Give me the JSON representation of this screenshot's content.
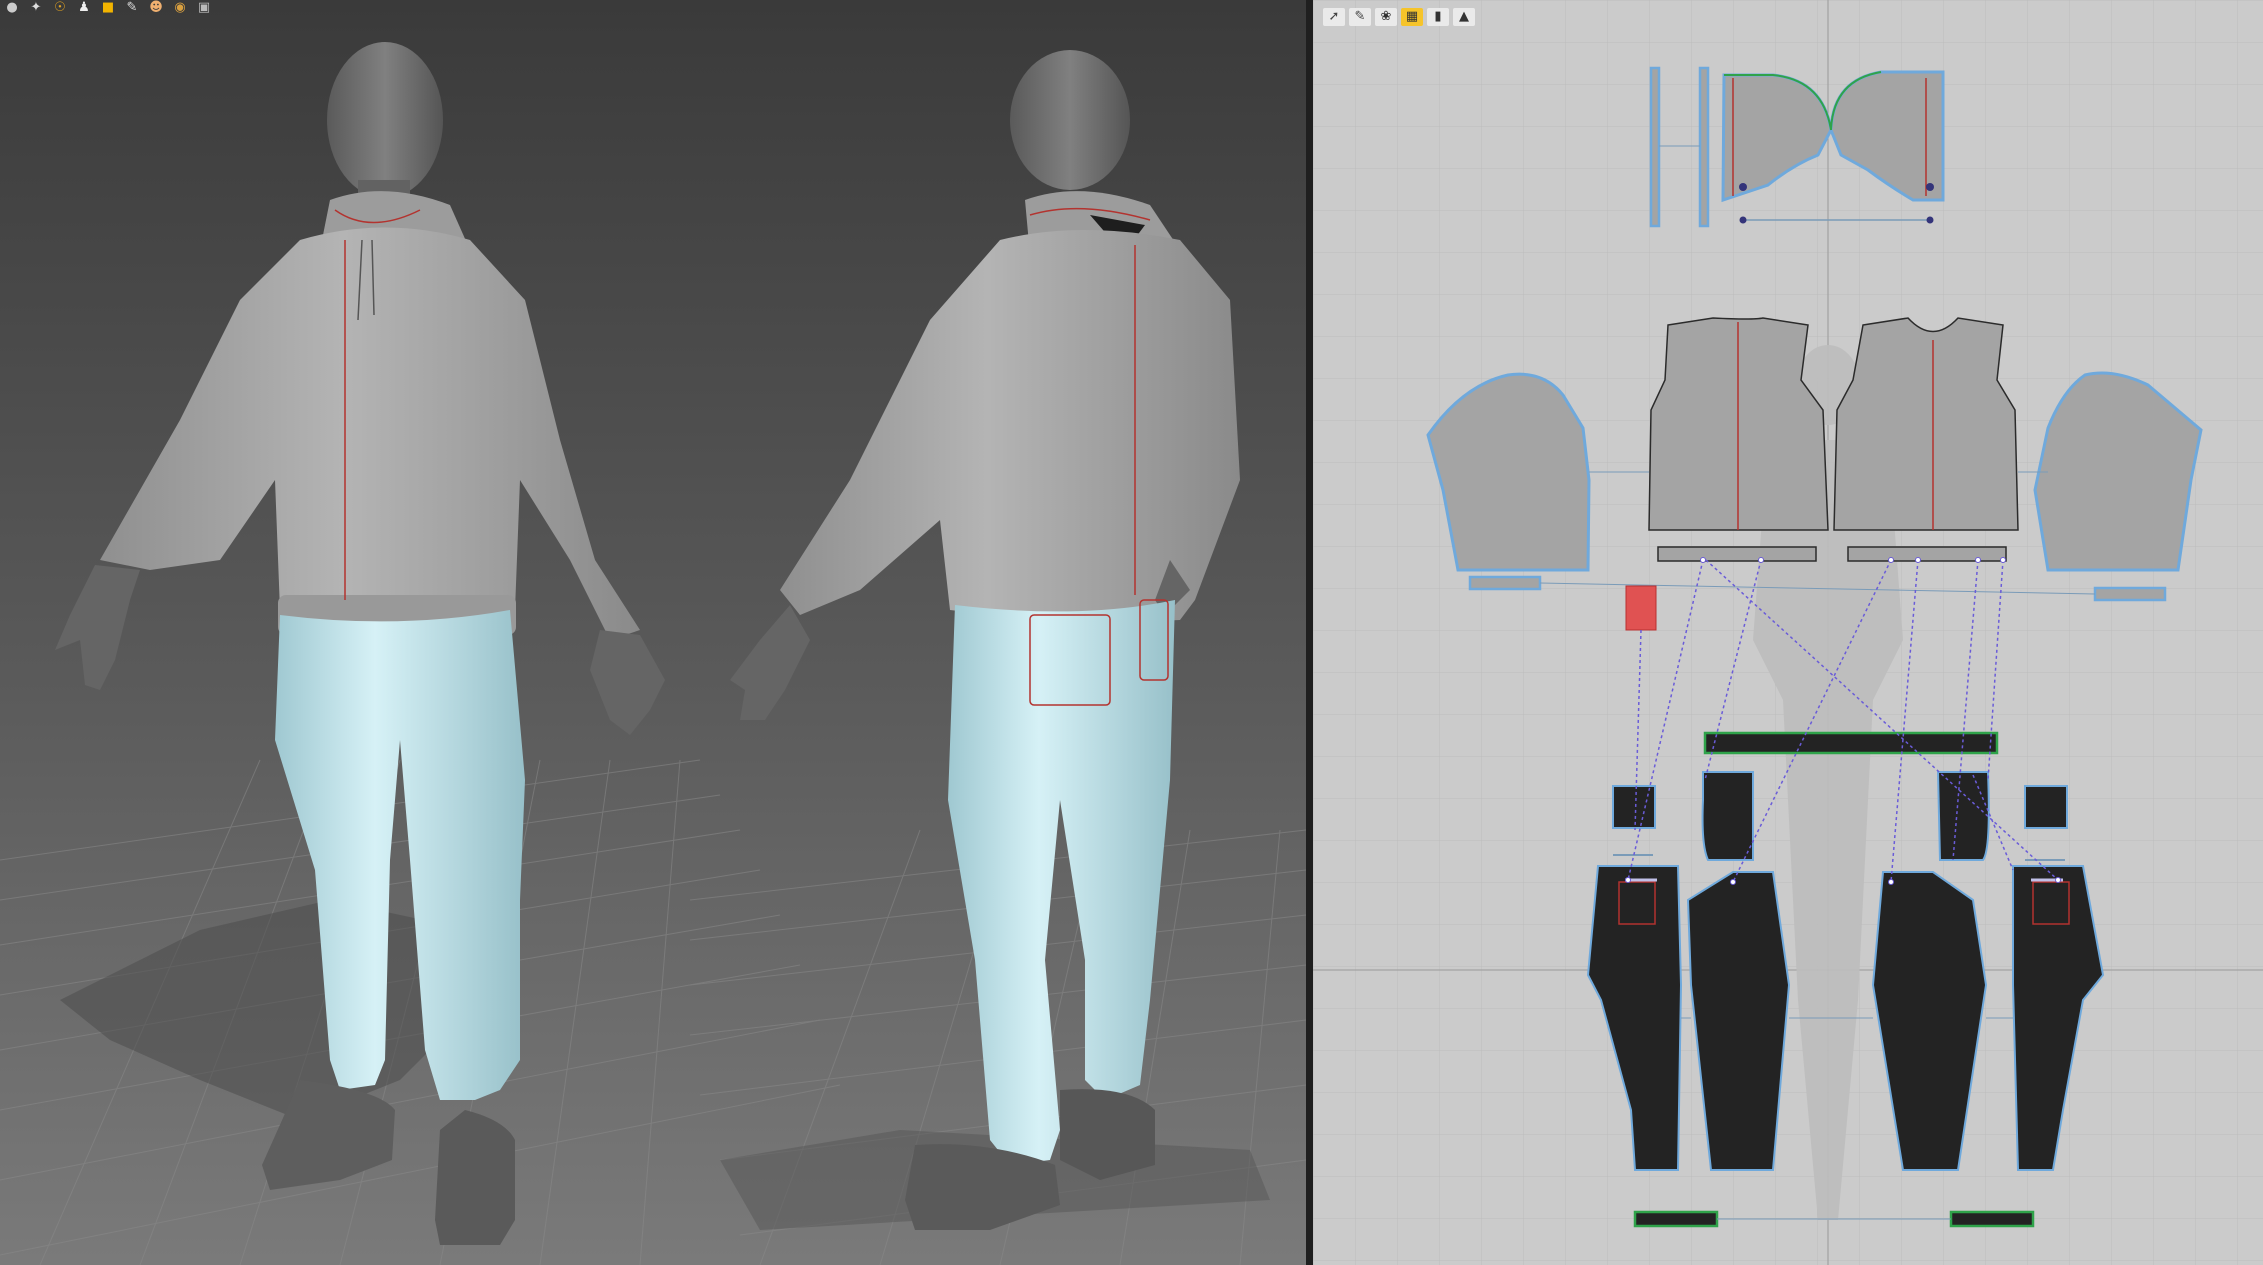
{
  "app": {
    "panels": [
      "3D Garment",
      "2D Pattern"
    ]
  },
  "toolbar_3d": {
    "icons": [
      "select-mesh-icon",
      "move-icon",
      "simulate-icon",
      "avatar-icon",
      "fold-icon",
      "pin-icon",
      "avatar-display-icon",
      "texture-icon",
      "export-icon"
    ]
  },
  "toolbar_2d": {
    "icons": [
      "transform-pattern-icon",
      "edit-pattern-icon",
      "segment-icon",
      "internal-line-icon",
      "trace-icon",
      "export-icon"
    ]
  },
  "colors": {
    "viewport_3d_top": "#3b3b3b",
    "viewport_3d_bottom": "#6e6e6e",
    "hoodie": "#a7a7a7",
    "pants": "#c6e7ee",
    "avatar": "#6a6a6a",
    "seam_red": "#b3332f",
    "pattern_gray": "#a4a4a4",
    "pattern_dark": "#232323",
    "outline_blue": "#6fa9dc",
    "binding_green": "#2fa34a",
    "selected_red": "#e05252",
    "sewing_dashed": "#6a5cd8",
    "pattern_bg": "#cbcbcb",
    "grid_line": "#bdbdbd"
  }
}
